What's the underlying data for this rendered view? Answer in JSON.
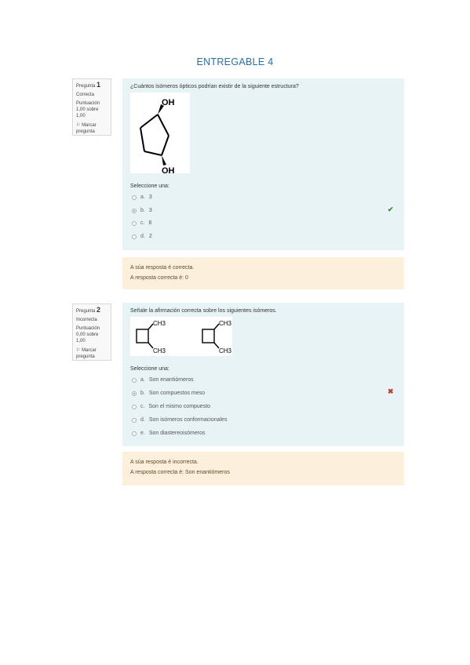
{
  "title": "ENTREGABLE 4",
  "q1": {
    "label": "Pregunta",
    "number": "1",
    "state": "Correcta",
    "score": "Puntuación 1,00 sobre 1,00",
    "flag": "Marcar pregunta",
    "text": "¿Cuántos isómeros ópticos podrían existir de la siguiente estructura?",
    "oh_top": "OH",
    "oh_bottom": "OH",
    "select_label": "Seleccione una:",
    "options": [
      {
        "letter": "a.",
        "text": "3"
      },
      {
        "letter": "b.",
        "text": "3"
      },
      {
        "letter": "c.",
        "text": "6"
      },
      {
        "letter": "d.",
        "text": "2"
      }
    ],
    "feedback_1": "A súa resposta é correcta.",
    "feedback_2": "A resposta correcta é: 0"
  },
  "q2": {
    "label": "Pregunta",
    "number": "2",
    "state": "Incorrecta",
    "score": "Puntuación 0,00 sobre 1,00",
    "flag": "Marcar pregunta",
    "text": "Señale la afirmación correcta sobre los siguientes isómeros.",
    "ch3_a1": "CH3",
    "ch3_a2": "CH3",
    "ch3_b1": "CH3",
    "ch3_b2": "CH3",
    "select_label": "Seleccione una:",
    "options": [
      {
        "letter": "a.",
        "text": "Son enantiómeros"
      },
      {
        "letter": "b.",
        "text": "Son compuestos meso"
      },
      {
        "letter": "c.",
        "text": "Son el mismo compuesto"
      },
      {
        "letter": "d.",
        "text": "Son isómeros conformacionales"
      },
      {
        "letter": "e.",
        "text": "Son diastereoisómeros"
      }
    ],
    "feedback_1": "A súa resposta é incorrecta.",
    "feedback_2": "A resposta correcta é: Son enantiómeros"
  },
  "icons": {
    "check": "check-icon",
    "cross": "cross-icon"
  },
  "colors": {
    "accent": "#2a6fa6",
    "question_bg": "#e7f3f5",
    "feedback_bg": "#fcefdc",
    "correct": "#3a8a3a",
    "incorrect": "#c0392b"
  }
}
